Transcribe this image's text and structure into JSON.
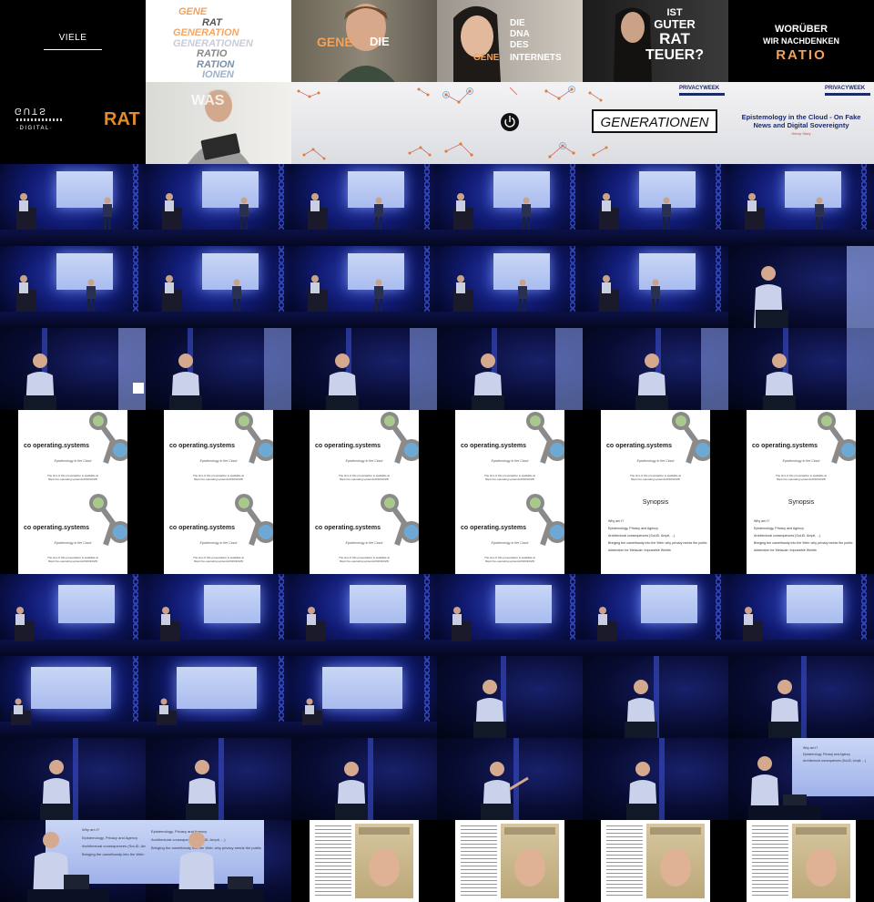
{
  "title_frames": {
    "viele": "VIELE",
    "word_stack": [
      "GENE",
      "RAT",
      "GENERATION",
      "GENERATIONEN",
      "RATIO",
      "RATION",
      "IONEN"
    ],
    "gene_die": {
      "gene": "GENE",
      "die": "DIE"
    },
    "dna": {
      "die": "DIE",
      "dna": "DNA",
      "des": "DES",
      "gene": "GENE",
      "internets": "INTERNETS"
    },
    "ist_guter_rat": {
      "ist": "IST",
      "guter": "GUTER",
      "rat": "RAT",
      "teuer": "TEUER?"
    },
    "woruber": {
      "line1": "WORÜBER",
      "line2": "WIR NACHDENKEN",
      "ratio": "RATIO"
    },
    "digital": {
      "guts": "GUTS",
      "digital": "·DIGITAL·",
      "rat": "RAT"
    },
    "was": {
      "text": "WAS"
    },
    "generationen_box": "GENERATIONEN",
    "privacyweek_logo": "PRIVACYWEEK",
    "talk_title": "Epistemology in the Cloud - On Fake News and Digital Sovereignty",
    "speaker": "Henry Story"
  },
  "slides": {
    "logo": "co operating.systems",
    "subtitle": "Epistemology in the Cloud",
    "url_note": "The text of this presentation is available at",
    "url": "https://co-operating.systems/2019/10/26/",
    "synopsis_title": "Synopsis",
    "synopsis_items": [
      "Why am I?",
      "Epistemology, Privacy and Agency",
      "Architectural consequences (SoLiD, Ampit, ...)",
      "Bringing the camelhandy into the Web: why privacy needs the public",
      "Addendum for MetaLab: Impossible Worlds"
    ]
  },
  "colors": {
    "stage_blue": "#1b2aa0",
    "accent_orange": "#f1a15a",
    "logo_green": "#a9c98a",
    "logo_blue": "#6ea9d6",
    "logo_grey": "#8a8a8a"
  }
}
